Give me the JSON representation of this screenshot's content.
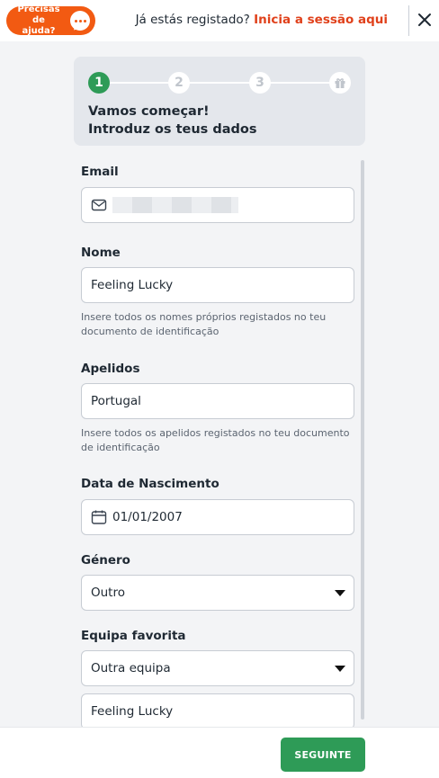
{
  "header": {
    "help_label": "Precisas de ajuda?",
    "login_prompt": "Já estás registado?",
    "login_link": "Inicia a sessão aqui"
  },
  "steps": {
    "items": [
      "1",
      "2",
      "3"
    ],
    "current": 1,
    "title_line1": "Vamos começar!",
    "title_line2": "Introduz os teus dados"
  },
  "form": {
    "email": {
      "label": "Email",
      "value": ""
    },
    "name": {
      "label": "Nome",
      "value": "Feeling Lucky",
      "hint": "Insere todos os nomes próprios registados no teu documento de identificação"
    },
    "surname": {
      "label": "Apelidos",
      "value": "Portugal",
      "hint": "Insere todos os apelidos registados no teu documento de identificação"
    },
    "birthdate": {
      "label": "Data de Nascimento",
      "value": "01/01/2007"
    },
    "gender": {
      "label": "Género",
      "value": "Outro"
    },
    "team": {
      "label": "Equipa favorita",
      "value": "Outra equipa",
      "other_value": "Feeling Lucky"
    }
  },
  "footer": {
    "next_label": "SEGUINTE"
  },
  "colors": {
    "accent_orange": "#f25a12",
    "link_red": "#e0411b",
    "primary_green": "#2e9b57"
  }
}
